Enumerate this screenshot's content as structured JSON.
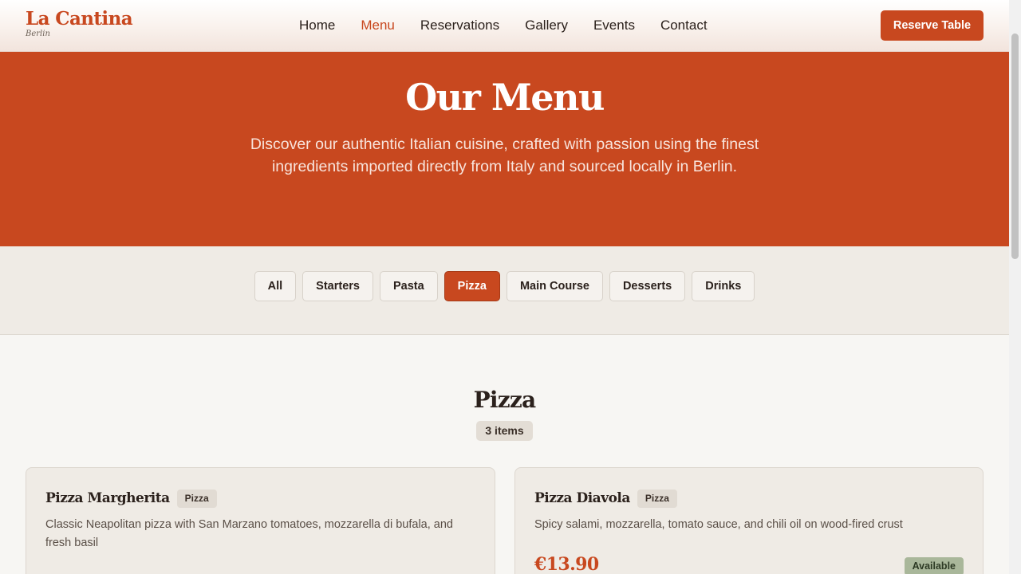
{
  "header": {
    "brand_name": "La Cantina",
    "brand_sub": "Berlin",
    "nav": [
      {
        "label": "Home",
        "active": false
      },
      {
        "label": "Menu",
        "active": true
      },
      {
        "label": "Reservations",
        "active": false
      },
      {
        "label": "Gallery",
        "active": false
      },
      {
        "label": "Events",
        "active": false
      },
      {
        "label": "Contact",
        "active": false
      }
    ],
    "reserve_label": "Reserve Table"
  },
  "hero": {
    "title": "Our Menu",
    "description": "Discover our authentic Italian cuisine, crafted with passion using the finest ingredients imported directly from Italy and sourced locally in Berlin."
  },
  "filters": [
    {
      "label": "All",
      "active": false
    },
    {
      "label": "Starters",
      "active": false
    },
    {
      "label": "Pasta",
      "active": false
    },
    {
      "label": "Pizza",
      "active": true
    },
    {
      "label": "Main Course",
      "active": false
    },
    {
      "label": "Desserts",
      "active": false
    },
    {
      "label": "Drinks",
      "active": false
    }
  ],
  "section": {
    "title": "Pizza",
    "count": "3 items"
  },
  "items": [
    {
      "name": "Pizza Margherita",
      "category": "Pizza",
      "description": "Classic Neapolitan pizza with San Marzano tomatoes, mozzarella di bufala, and fresh basil",
      "price": "",
      "availability": ""
    },
    {
      "name": "Pizza Diavola",
      "category": "Pizza",
      "description": "Spicy salami, mozzarella, tomato sauce, and chili oil on wood-fired crust",
      "price": "€13.90",
      "availability": "Available"
    }
  ],
  "colors": {
    "accent": "#c8481f",
    "background": "#f7f6f3",
    "card": "#efebe5",
    "available": "#a9b79a"
  }
}
